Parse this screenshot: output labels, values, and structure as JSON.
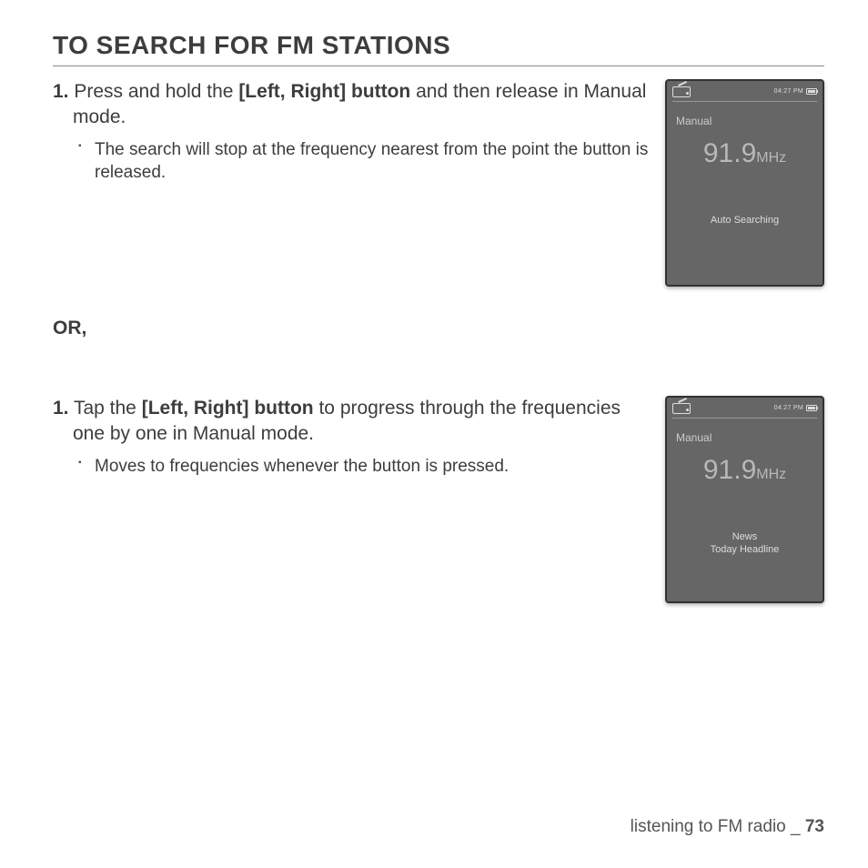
{
  "heading": "TO SEARCH FOR FM STATIONS",
  "section1": {
    "step_num": "1.",
    "step_pre": " Press and hold the ",
    "step_bold": "[Left, Right] button",
    "step_post": " and then release in Manual mode.",
    "bullet": "The search will stop at the frequency nearest from the point the button is released."
  },
  "or_label": "OR,",
  "section2": {
    "step_num": "1.",
    "step_pre": " Tap the ",
    "step_bold": "[Left, Right] button",
    "step_post": " to progress through the frequencies one by one in Manual mode.",
    "bullet": "Moves to frequencies whenever the button is pressed."
  },
  "device1": {
    "time": "04:27 PM",
    "mode": "Manual",
    "freq_num": "91.9",
    "freq_unit": "MHz",
    "bottom_line1": "Auto Searching",
    "bottom_line2": ""
  },
  "device2": {
    "time": "04:27 PM",
    "mode": "Manual",
    "freq_num": "91.9",
    "freq_unit": "MHz",
    "bottom_line1": "News",
    "bottom_line2": "Today Headline"
  },
  "footer": {
    "text": "listening to FM radio _ ",
    "page": "73"
  }
}
